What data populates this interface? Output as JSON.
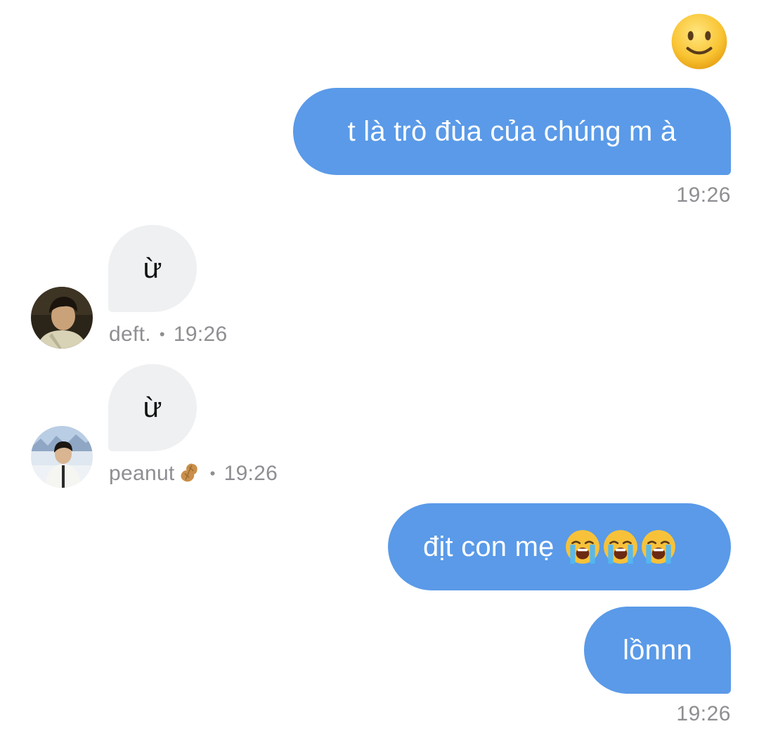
{
  "messages": {
    "m1_text": "t là trò đùa của chúng m à",
    "m1_time": "19:26",
    "m2_text": "ừ",
    "m2_sender": "deft.",
    "m2_time": "19:26",
    "m3_text": "ừ",
    "m3_sender": "peanut",
    "m3_time": "19:26",
    "m4_text": "địt con mẹ",
    "m5_text": "lồnnn",
    "m5_time": "19:26"
  },
  "separator": "•",
  "icons": {
    "top_emoji": "slightly-smiling-face-icon",
    "crying": "loudly-crying-face-icon",
    "peanut": "peanut-icon"
  },
  "colors": {
    "outgoing_bubble": "#5a9ae8",
    "incoming_bubble": "#eff0f2",
    "timestamp": "#8e8e93"
  }
}
